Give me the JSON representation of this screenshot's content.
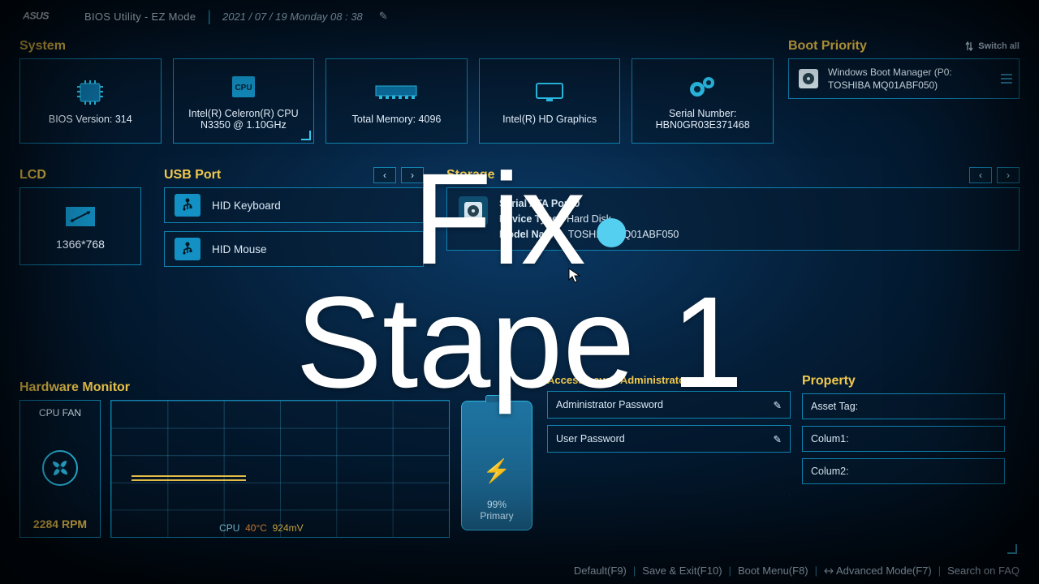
{
  "header": {
    "brand": "ASUS",
    "title": "BIOS Utility - EZ Mode",
    "date": "2021 / 07 / 19  Monday  08 : 38"
  },
  "system": {
    "heading": "System",
    "bios_label": "BIOS Version: 314",
    "cpu_label": "Intel(R) Celeron(R) CPU N3350 @ 1.10GHz",
    "mem_label": "Total Memory: 4096",
    "gpu_label": "Intel(R) HD Graphics",
    "serial_label": "Serial Number: HBN0GR03E371468"
  },
  "boot": {
    "heading": "Boot Priority",
    "switch": "Switch all",
    "item_line1": "Windows Boot Manager (P0:",
    "item_line2": "TOSHIBA MQ01ABF050)"
  },
  "lcd": {
    "heading": "LCD",
    "res": "1366*768"
  },
  "usb": {
    "heading": "USB Port",
    "items": [
      "HID Keyboard",
      "HID Mouse"
    ]
  },
  "storage": {
    "heading": "Storage",
    "port_line": "Serial ATA Port 0",
    "type_label": "Device Type:",
    "type_val": "Hard Disk",
    "model_label": "Model Name:",
    "model_val": "TOSHIBA MQ01ABF050"
  },
  "hw": {
    "heading": "Hardware Monitor",
    "fan_title": "CPU FAN",
    "rpm": "2284 RPM",
    "cpu": "CPU",
    "temp": "40°C",
    "volt": "924mV"
  },
  "batt": {
    "pct": "99%",
    "label": "Primary"
  },
  "access": {
    "heading": "Access Level: Administrator",
    "row1": "Administrator Password",
    "row2": "User Password"
  },
  "prop": {
    "heading": "Property",
    "r1": "Asset Tag:",
    "r2": "Colum1:",
    "r3": "Colum2:"
  },
  "footer": {
    "a": "Default(F9)",
    "b": "Save & Exit(F10)",
    "c": "Boot Menu(F8)",
    "d": "Advanced Mode(F7)",
    "e": "Search on FAQ"
  },
  "overlay": {
    "l1": "Fix",
    "l2": "Stape 1"
  }
}
